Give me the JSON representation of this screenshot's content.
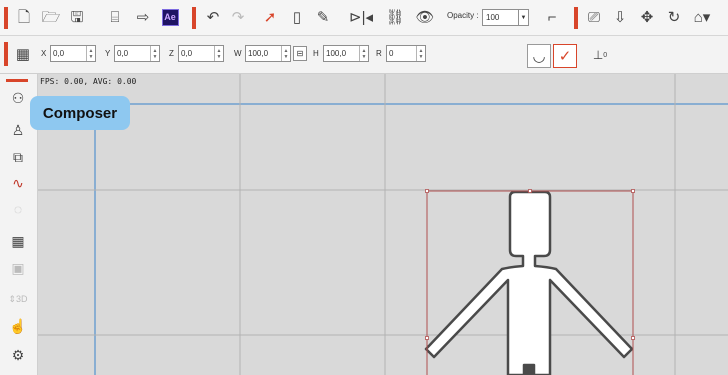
{
  "toolbar": {
    "icons": [
      "new-file-icon",
      "open-folder-icon",
      "save-icon",
      "scene-icon",
      "export-icon",
      "after-effects-icon",
      "undo-icon",
      "redo-icon",
      "select-arrow-icon",
      "transform-icon",
      "edit-icon",
      "flip-icon",
      "link-icon",
      "visibility-icon",
      "bone-icon",
      "camera-icon",
      "move-down-icon",
      "move-icon",
      "rotate-icon",
      "home-icon"
    ],
    "ae_label": "Ae",
    "opacity_label": "Opacity :",
    "opacity_value": "100"
  },
  "transform_bar": {
    "x_label": "X",
    "x_value": "0,0",
    "y_label": "Y",
    "y_value": "0,0",
    "z_label": "Z",
    "z_value": "0,0",
    "w_label": "W",
    "w_value": "100,0",
    "h_label": "H",
    "h_value": "100,0",
    "r_label": "R",
    "r_value": "0",
    "link_icon": "link-icon",
    "pivot_label": "0"
  },
  "sidebar": {
    "items": [
      "composer-icon",
      "add-actor-icon",
      "scene-manager-icon",
      "audio-icon",
      "disabled-icon",
      "grid-icon",
      "disabled-frame-icon",
      "disabled-3d-icon",
      "hand-icon",
      "pose-icon"
    ]
  },
  "canvas": {
    "fps_text": "FPS: 0.00, AVG: 0.00",
    "tooltip": "Composer"
  },
  "colors": {
    "accent": "#d8452a",
    "tooltip_bg": "#8ec8f0",
    "canvas_bg": "#d9d9d9"
  }
}
